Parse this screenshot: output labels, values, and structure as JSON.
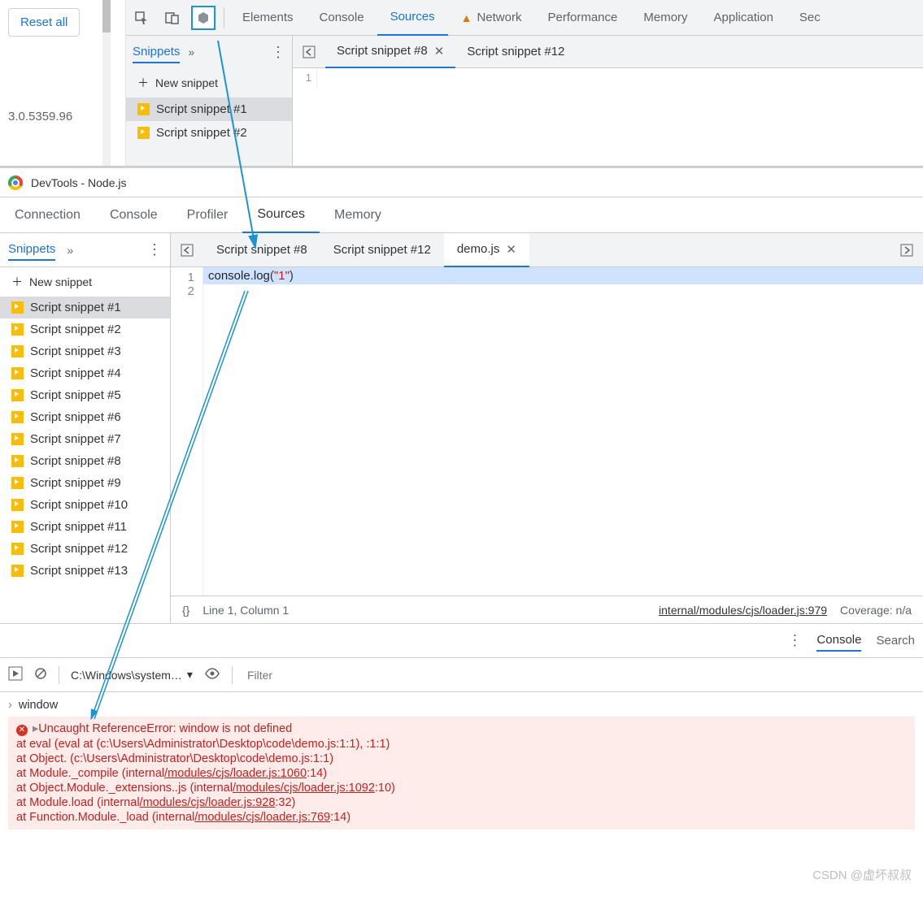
{
  "top": {
    "reset": "Reset all",
    "version": "3.0.5359.96",
    "tabs": [
      "Elements",
      "Console",
      "Sources",
      "Network",
      "Performance",
      "Memory",
      "Application",
      "Sec"
    ],
    "active_tab": "Sources",
    "network_warning": true,
    "sidebar": {
      "tab": "Snippets",
      "overflow": "»",
      "new": "New snippet",
      "items": [
        "Script snippet #1",
        "Script snippet #2"
      ],
      "selected": 0
    },
    "files": {
      "tabs": [
        "Script snippet #8",
        "Script snippet #12"
      ],
      "active": 0,
      "gutter": [
        "1"
      ]
    }
  },
  "win2": {
    "title": "DevTools - Node.js",
    "tabs": [
      "Connection",
      "Console",
      "Profiler",
      "Sources",
      "Memory"
    ],
    "active_tab": "Sources",
    "sidebar": {
      "tab": "Snippets",
      "overflow": "»",
      "new": "New snippet",
      "items": [
        "Script snippet #1",
        "Script snippet #2",
        "Script snippet #3",
        "Script snippet #4",
        "Script snippet #5",
        "Script snippet #6",
        "Script snippet #7",
        "Script snippet #8",
        "Script snippet #9",
        "Script snippet #10",
        "Script snippet #11",
        "Script snippet #12",
        "Script snippet #13"
      ],
      "selected": 0
    },
    "files": {
      "tabs": [
        "Script snippet #8",
        "Script snippet #12",
        "demo.js"
      ],
      "active": 2,
      "code": {
        "line1": "console.log(\"1\")",
        "gutter": [
          "1",
          "2"
        ]
      }
    },
    "status": {
      "braces": "{}",
      "pos": "Line 1, Column 1",
      "link": "internal/modules/cjs/loader.js:979",
      "coverage": "Coverage: n/a"
    }
  },
  "drawer": {
    "tabs": [
      "Console",
      "Search"
    ],
    "active": "Console",
    "context": "C:\\Windows\\system…",
    "filter_placeholder": "Filter",
    "input": "window",
    "error": {
      "head": "Uncaught ReferenceError: window is not defined",
      "stack": [
        {
          "pre": "    at eval (eval at <anonymous> (c:\\Users\\Administrator\\Desktop\\code\\demo.js:1:1), <anonymous>:1:1)"
        },
        {
          "pre": "    at Object.<anonymous> (c:\\Users\\Administrator\\Desktop\\code\\demo.js:1:1)"
        },
        {
          "pre": "    at Module._compile (internal",
          "ul": "/modules/cjs/loader.js:1060",
          "post": ":14)"
        },
        {
          "pre": "    at Object.Module._extensions..js (internal",
          "ul": "/modules/cjs/loader.js:1092",
          "post": ":10)"
        },
        {
          "pre": "    at Module.load (internal",
          "ul": "/modules/cjs/loader.js:928",
          "post": ":32)"
        },
        {
          "pre": "    at Function.Module._load (internal",
          "ul": "/modules/cjs/loader.js:769",
          "post": ":14)"
        }
      ]
    }
  },
  "watermark": "CSDN @虚坏叔叔"
}
